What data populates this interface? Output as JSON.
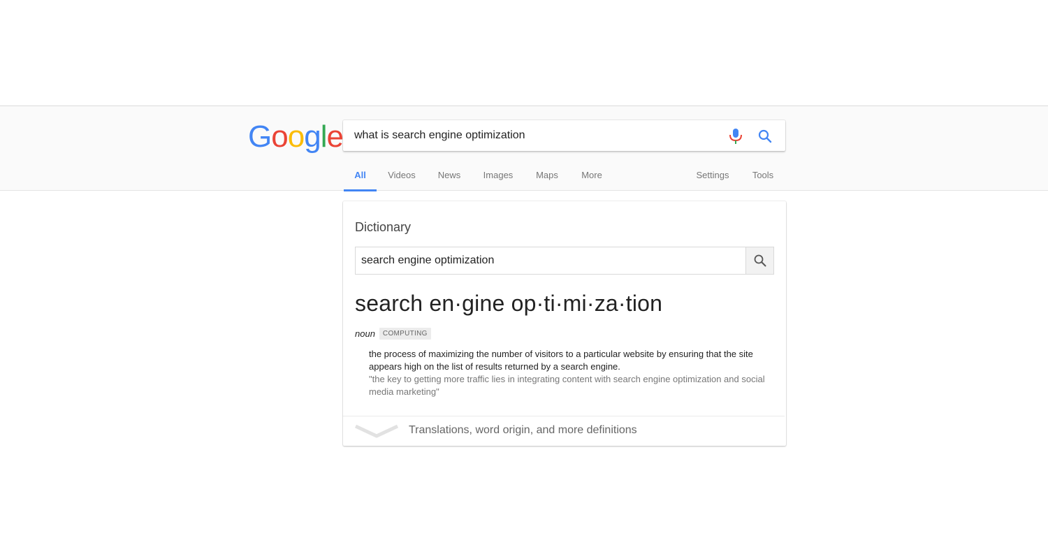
{
  "logo": {
    "letters": [
      "G",
      "o",
      "o",
      "g",
      "l",
      "e"
    ],
    "colors": [
      "#4285f4",
      "#ea4335",
      "#fbbc05",
      "#4285f4",
      "#34a853",
      "#ea4335"
    ]
  },
  "search": {
    "query": "what is search engine optimization"
  },
  "icons": {
    "mic": "microphone-icon",
    "search": "search-icon",
    "dict_search": "search-icon",
    "more": "chevron-down-icon"
  },
  "tabs": [
    {
      "label": "All",
      "active": true
    },
    {
      "label": "Videos",
      "active": false
    },
    {
      "label": "News",
      "active": false
    },
    {
      "label": "Images",
      "active": false
    },
    {
      "label": "Maps",
      "active": false
    },
    {
      "label": "More",
      "active": false
    }
  ],
  "tools": [
    {
      "label": "Settings"
    },
    {
      "label": "Tools"
    }
  ],
  "dictionary": {
    "title": "Dictionary",
    "input_value": "search engine optimization",
    "headword": "search en·gine op·ti·mi·za·tion",
    "part_of_speech": "noun",
    "domain": "COMPUTING",
    "definition": "the process of maximizing the number of visitors to a particular website by ensuring that the site appears high on the list of results returned by a search engine.",
    "example": "\"the key to getting more traffic lies in integrating content with search engine optimization and social media marketing\"",
    "more_label": "Translations, word origin, and more definitions"
  },
  "colors": {
    "accent": "#4285f4",
    "header_bg": "#fafafa"
  }
}
